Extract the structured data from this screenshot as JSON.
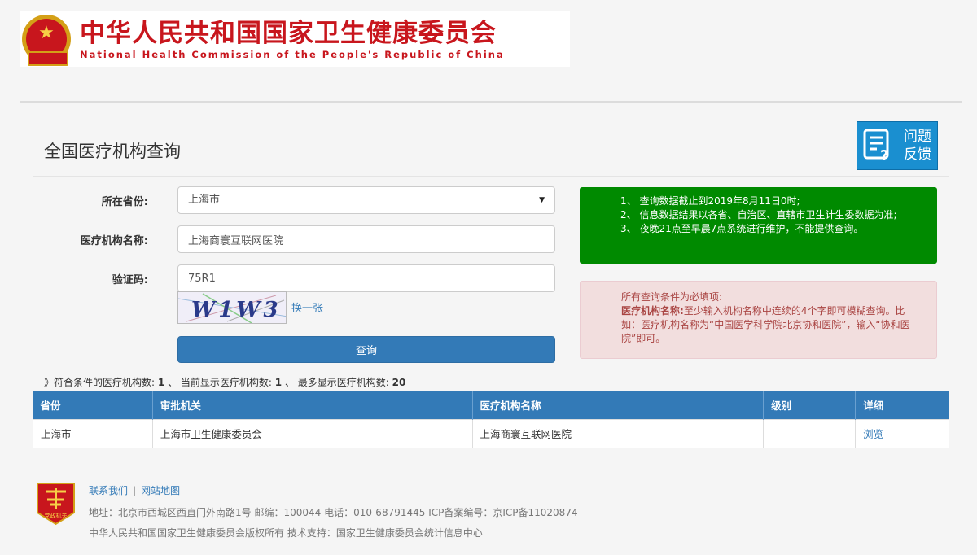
{
  "header": {
    "title_cn": "中华人民共和国国家卫生健康委员会",
    "title_en": "National Health Commission of the People's Republic of China"
  },
  "page": {
    "title": "全国医疗机构查询",
    "feedback_label": "问题反馈"
  },
  "form": {
    "province_label": "所在省份:",
    "province_value": "上海市",
    "name_label": "医疗机构名称:",
    "name_value": "上海商寰互联网医院",
    "captcha_label": "验证码:",
    "captcha_value": "75R1",
    "captcha_image_text": "W1W3",
    "captcha_refresh": "换一张",
    "search_button": "查询"
  },
  "notices": {
    "green": [
      "1、 查询数据截止到2019年8月11日0时;",
      "2、 信息数据结果以各省、自治区、直辖市卫生计生委数据为准;",
      "3、 夜晚21点至早晨7点系统进行维护，不能提供查询。"
    ],
    "red_title": "所有查询条件为必填项:",
    "red_label": "医疗机构名称:",
    "red_body": "至少输入机构名称中连续的4个字即可模糊查询。比如：医疗机构名称为“中国医学科学院北京协和医院”，输入“协和医院”即可。"
  },
  "results": {
    "prefix": "》符合条件的医疗机构数:",
    "matched": "1",
    "current_label": "、 当前显示医疗机构数:",
    "current": "1",
    "max_label": "、 最多显示医疗机构数:",
    "max": "20",
    "columns": [
      "省份",
      "审批机关",
      "医疗机构名称",
      "级别",
      "详细"
    ],
    "rows": [
      {
        "province": "上海市",
        "authority": "上海市卫生健康委员会",
        "name": "上海商寰互联网医院",
        "level": "",
        "detail": "浏览"
      }
    ]
  },
  "footer": {
    "logo_text": "党政机关",
    "contact": "联系我们",
    "sitemap": "网站地图",
    "address_line": "地址：北京市西城区西直门外南路1号    邮编：100044    电话：010-68791445    ICP备案编号：京ICP备11020874",
    "copyright_line": "中华人民共和国国家卫生健康委员会版权所有    技术支持：国家卫生健康委员会统计信息中心"
  },
  "colors": {
    "brand_red": "#c8161d",
    "primary_blue": "#337ab7",
    "notice_green": "#008a00",
    "notice_red_bg": "#f2dede"
  }
}
